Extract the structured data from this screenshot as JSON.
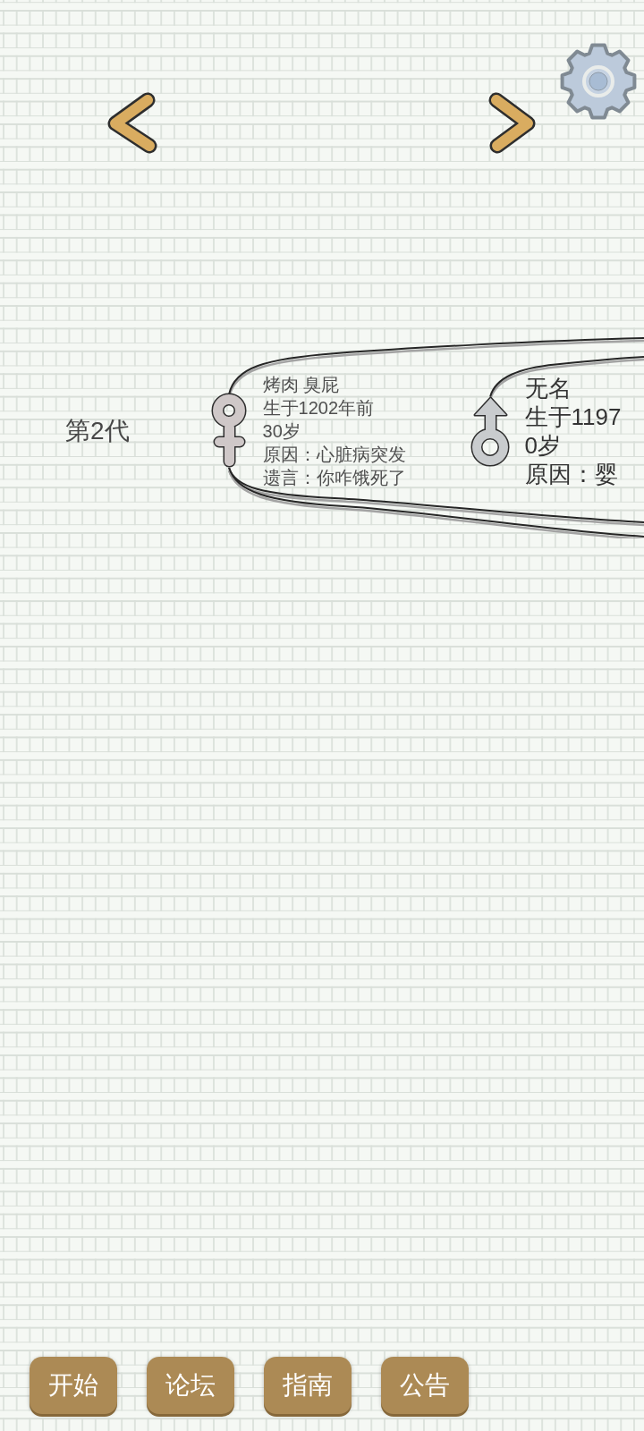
{
  "tree": {
    "generation": "第2代",
    "members": [
      {
        "kind": "female",
        "name": "烤肉 臭屁",
        "born": "生于1202年前",
        "age": "30岁",
        "cause": "原因：心脏病突发",
        "last_words": "遗言：你咋饿死了"
      },
      {
        "kind": "male",
        "name": "无名",
        "born": "生于1197",
        "age": "0岁",
        "cause": "原因：婴"
      }
    ]
  },
  "buttons": [
    {
      "label": "开始"
    },
    {
      "label": "论坛"
    },
    {
      "label": "指南"
    },
    {
      "label": "公告"
    }
  ]
}
